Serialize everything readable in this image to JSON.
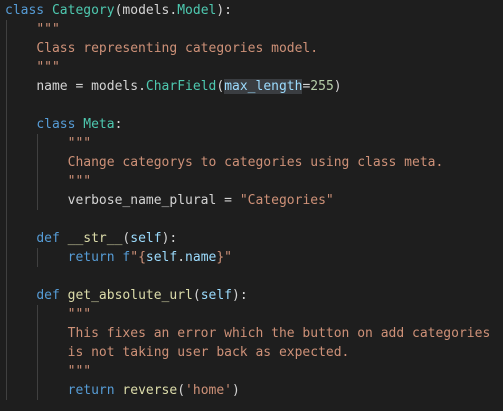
{
  "code": {
    "line1": {
      "kw": "class",
      "cls": "Category",
      "p1": "(models.",
      "base": "Model",
      "p2": "):"
    },
    "line2": {
      "text": "\"\"\""
    },
    "line3": {
      "text": "Class representing categories model."
    },
    "line4": {
      "text": "\"\"\""
    },
    "line5": {
      "name": "name",
      "p1": " = models.",
      "fn": "CharField",
      "p2": "(",
      "arg": "max_length",
      "eq": "=",
      "num": "255",
      "p3": ")"
    },
    "line7": {
      "kw": "class",
      "cls": "Meta",
      "p1": ":"
    },
    "line8": {
      "text": "\"\"\""
    },
    "line9": {
      "text": "Change categorys to categories using class meta."
    },
    "line10": {
      "text": "\"\"\""
    },
    "line11": {
      "name": "verbose_name_plural",
      "p1": " = ",
      "str": "\"Categories\""
    },
    "line13": {
      "kw": "def",
      "fn": "__str__",
      "p1": "(",
      "arg": "self",
      "p2": "):"
    },
    "line14": {
      "kw": "return",
      "prefix": "f",
      "s1": "\"{",
      "var": "self",
      "dot": ".",
      "attr": "name",
      "s2": "}\""
    },
    "line16": {
      "kw": "def",
      "fn": "get_absolute_url",
      "p1": "(",
      "arg": "self",
      "p2": "):"
    },
    "line17": {
      "text": "\"\"\""
    },
    "line18": {
      "text": "This fixes an error which the button on add categories"
    },
    "line19": {
      "text": "is not taking user back as expected."
    },
    "line20": {
      "text": "\"\"\""
    },
    "line21": {
      "kw": "return",
      "fn": "reverse",
      "p1": "(",
      "str": "'home'",
      "p2": ")"
    }
  },
  "colors": {
    "background": "#1e1e1e",
    "keyword": "#569cd6",
    "class_name": "#4ec9b0",
    "function": "#dcdcaa",
    "string": "#ce9178",
    "number": "#b5cea8",
    "variable": "#9cdcfe",
    "plain": "#d4d4d4"
  }
}
